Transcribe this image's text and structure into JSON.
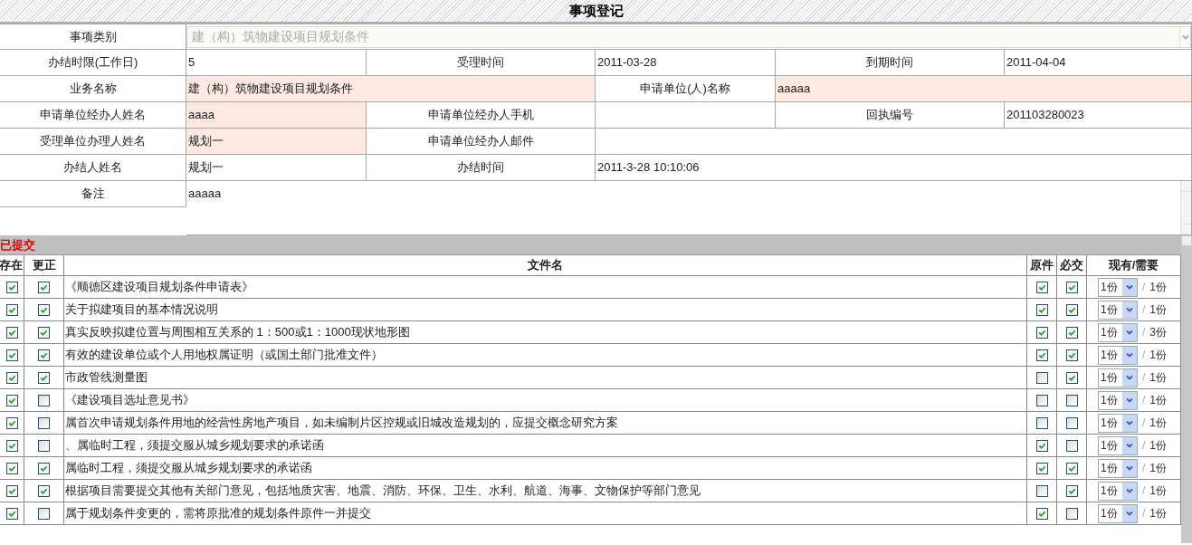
{
  "window": {
    "title": "事项登记"
  },
  "form": {
    "rows": [
      {
        "kind": "single",
        "cells": [
          {
            "kind": "label",
            "text": "事项类别"
          },
          {
            "kind": "select",
            "text": "建（构）筑物建设项目规划条件",
            "disabled": true
          }
        ]
      },
      {
        "kind": "triple",
        "cells": [
          {
            "kind": "label",
            "text": "办结时限(工作日)"
          },
          {
            "kind": "value",
            "text": "5",
            "highlighted": false
          },
          {
            "kind": "label",
            "text": "受理时间"
          },
          {
            "kind": "value",
            "text": "2011-03-28",
            "highlighted": false
          },
          {
            "kind": "label",
            "text": "到期时间"
          },
          {
            "kind": "value",
            "text": "2011-04-04",
            "highlighted": false
          }
        ]
      },
      {
        "kind": "double",
        "cells": [
          {
            "kind": "label",
            "text": "业务名称"
          },
          {
            "kind": "value",
            "text": "建（构）筑物建设项目规划条件",
            "highlighted": true
          },
          {
            "kind": "label",
            "text": "申请单位(人)名称"
          },
          {
            "kind": "value",
            "text": "aaaaa",
            "highlighted": true
          }
        ]
      },
      {
        "kind": "triple",
        "cells": [
          {
            "kind": "label",
            "text": "申请单位经办人姓名"
          },
          {
            "kind": "value",
            "text": "aaaa",
            "highlighted": true
          },
          {
            "kind": "label",
            "text": "申请单位经办人手机"
          },
          {
            "kind": "value",
            "highlighted": false
          },
          {
            "kind": "label",
            "text": "回执编号"
          },
          {
            "kind": "value",
            "text": "201103280023",
            "highlighted": false
          }
        ]
      },
      {
        "kind": "pair_wide",
        "cells": [
          {
            "kind": "label",
            "text": "受理单位办理人姓名"
          },
          {
            "kind": "value",
            "text": "规划一",
            "highlighted": true
          },
          {
            "kind": "label",
            "text": "申请单位经办人邮件"
          },
          {
            "kind": "value",
            "highlighted": false
          }
        ]
      },
      {
        "kind": "pair_wide",
        "cells": [
          {
            "kind": "label",
            "text": "办结人姓名"
          },
          {
            "kind": "value",
            "text": "规划一",
            "highlighted": false
          },
          {
            "kind": "label",
            "text": "办结时间"
          },
          {
            "kind": "value",
            "text": "2011-3-28 10:10:06",
            "highlighted": false
          }
        ]
      },
      {
        "kind": "single",
        "cells": [
          {
            "kind": "label",
            "text": "备注"
          },
          {
            "kind": "textarea",
            "text": "aaaaa"
          }
        ]
      }
    ]
  },
  "submitted": {
    "heading": "已提交",
    "columns": [
      "存在",
      "更正",
      "文件名",
      "原件",
      "必交",
      "现有/需要"
    ],
    "rows": [
      {
        "exists": true,
        "corrected": true,
        "name": "《顺德区建设项目规划条件申请表》",
        "original": true,
        "required": true,
        "have": "1份",
        "slash": "/",
        "need": "1份"
      },
      {
        "exists": true,
        "corrected": true,
        "name": "关于拟建项目的基本情况说明",
        "original": true,
        "required": true,
        "have": "1份",
        "slash": "/",
        "need": "1份"
      },
      {
        "exists": true,
        "corrected": true,
        "name": "真实反映拟建位置与周围相互关系的 1：500或1：1000现状地形图",
        "original": true,
        "required": true,
        "have": "1份",
        "slash": "/",
        "need": "3份"
      },
      {
        "exists": true,
        "corrected": true,
        "name": "有效的建设单位或个人用地权属证明（或国土部门批准文件）",
        "original": true,
        "required": true,
        "have": "1份",
        "slash": "/",
        "need": "1份"
      },
      {
        "exists": true,
        "corrected": true,
        "name": "市政管线测量图",
        "original": false,
        "required": true,
        "have": "1份",
        "slash": "/",
        "need": "1份"
      },
      {
        "exists": true,
        "corrected": false,
        "name": "《建设项目选址意见书》",
        "original": false,
        "required": false,
        "have": "1份",
        "slash": "/",
        "need": "1份"
      },
      {
        "exists": true,
        "corrected": false,
        "name": "属首次申请规划条件用地的经营性房地产项目，如未编制片区控规或旧城改造规划的，应提交概念研究方案",
        "original": false,
        "required": false,
        "have": "1份",
        "slash": "/",
        "need": "1份"
      },
      {
        "exists": true,
        "corrected": false,
        "name": "、属临时工程，须提交服从城乡规划要求的承诺函",
        "original": true,
        "required": false,
        "have": "1份",
        "slash": "/",
        "need": "1份"
      },
      {
        "exists": true,
        "corrected": true,
        "name": "属临时工程，须提交服从城乡规划要求的承诺函",
        "original": true,
        "required": true,
        "have": "1份",
        "slash": "/",
        "need": "1份"
      },
      {
        "exists": true,
        "corrected": true,
        "name": "根据项目需要提交其他有关部门意见，包括地质灾害、地震、消防、环保、卫生、水利、航道、海事、文物保护等部门意见",
        "original": false,
        "required": true,
        "have": "1份",
        "slash": "/",
        "need": "1份"
      },
      {
        "exists": true,
        "corrected": false,
        "name": "属于规划条件变更的，需将原批准的规划条件原件一并提交",
        "original": true,
        "required": false,
        "have": "1份",
        "slash": "/",
        "need": "1份"
      }
    ]
  }
}
